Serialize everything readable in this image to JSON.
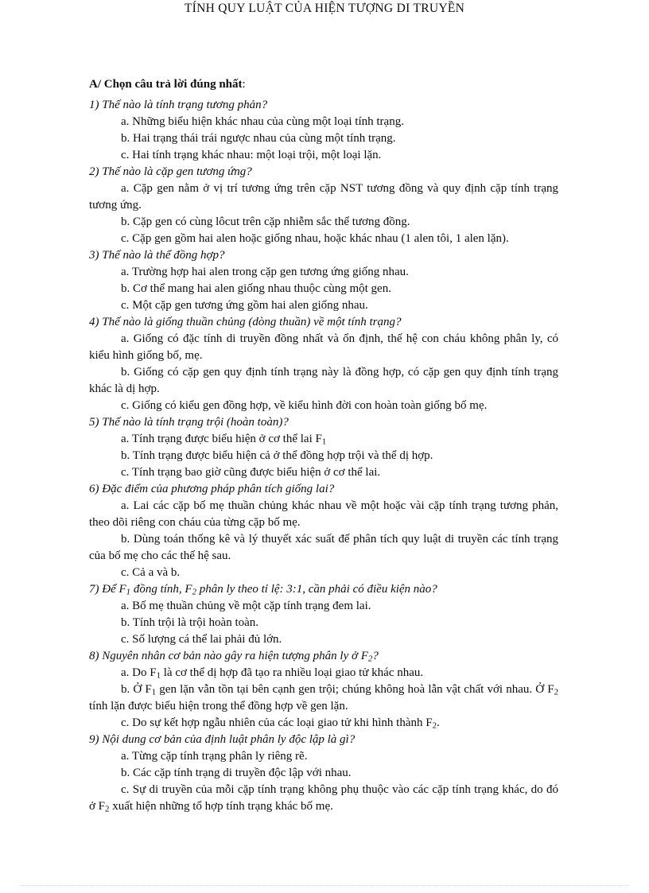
{
  "document": {
    "title": "TÍNH QUY LUẬT CỦA HIỆN TƯỢNG DI TRUYỀN",
    "section_label": "A/ Chọn câu trả lời đúng nhất",
    "section_label_tail": ":"
  },
  "questions": [
    {
      "number": "1)",
      "prompt": "1) Thế nào là tính trạng tương phản?",
      "options": [
        "a.  Những biểu hiện khác nhau của cùng một loại tính trạng.",
        "b.  Hai trạng thái trái ngược nhau của cùng một tính trạng.",
        "c.  Hai tính trạng khác nhau: một loại trội, một loại lặn."
      ]
    },
    {
      "number": "2)",
      "prompt": "2) Thế nào là cặp gen tương ứng?",
      "options": [
        "a.  Cặp gen nằm ở vị trí tương ứng trên cặp NST tương đồng và quy định cặp tính trạng tương ứng.",
        "b.  Cặp gen có cùng lôcut trên cặp nhiễm sắc thể tương đồng.",
        "c.  Cặp gen gồm hai alen hoặc giống nhau, hoặc khác nhau (1 alen tôi, 1 alen lặn)."
      ]
    },
    {
      "number": "3)",
      "prompt": "3) Thế nào là thể đồng hợp?",
      "options": [
        "a.  Trường hợp hai alen trong cặp gen tương ứng giống nhau.",
        "b.  Cơ thể mang hai alen giống nhau thuộc cùng một gen.",
        "c.  Một cặp gen tương ứng gồm hai alen giống nhau."
      ]
    },
    {
      "number": "4)",
      "prompt": "4) Thế nào là giống thuần chủng (dòng thuần) về một tính trạng?",
      "options": [
        "a.  Giống có đặc tính di truyền đồng nhất và ổn định, thế hệ con cháu không phân ly, có kiểu hình giống bố, mẹ.",
        "b.  Giống có cặp gen quy định tính trạng này là đồng hợp, có cặp gen quy định tính trạng khác là dị hợp.",
        "c.  Giống có kiểu gen đồng hợp, về kiểu hình đời con hoàn toàn giống bố mẹ."
      ]
    },
    {
      "number": "5)",
      "prompt": "5) Thế nào là tính trạng trội (hoàn toàn)?",
      "options": [
        "a.  Tính trạng được biểu hiện ở cơ thể lai F<sub>1</sub>",
        "b.  Tính trạng được biểu hiện cả ở thể đồng hợp trội và thể dị hợp.",
        "c.  Tính trạng bao giờ cũng được biểu hiện ở cơ thể lai."
      ]
    },
    {
      "number": "6)",
      "prompt": "6) Đặc điểm của phương pháp phân tích giống lai?",
      "options": [
        "a.  Lai các cặp bố mẹ thuần chủng khác nhau về một hoặc vài cặp tính trạng tương phản, theo dõi riêng con cháu của từng cặp bố mẹ.",
        "b.  Dùng toán thống kê và lý thuyết xác suất để phân tích quy luật di truyền các tính trạng của bố mẹ cho các thế hệ sau.",
        "c.  Cả a và b."
      ]
    },
    {
      "number": "7)",
      "prompt": "7) Để F<sub>1</sub> đồng tính, F<sub>2</sub> phân ly theo tỉ lệ: 3:1, cần phải có điều kiện nào?",
      "options": [
        "a.  Bố mẹ thuần chủng về một cặp tính trạng đem lai.",
        "b.  Tính trội là trội hoàn toàn.",
        "c.  Số lượng cá thể lai phải đủ lớn."
      ]
    },
    {
      "number": "8)",
      "prompt": "8) Nguyên nhân cơ bản nào gây ra hiện tượng phân ly ở F<sub>2</sub>?",
      "options": [
        "a.  Do F<sub>1</sub> là cơ thể dị hợp đã tạo ra nhiều loại giao tử khác nhau.",
        "b.  Ở F<sub>1</sub> gen lặn vẫn tồn tại bên cạnh gen trội; chúng không hoà lẫn vật chất với nhau. Ở F<sub>2</sub> tính lặn được biểu hiện trong thể đồng hợp về gen lặn.",
        "c.  Do sự kết hợp ngẫu nhiên của các loại giao tử khi hình thành F<sub>2</sub>."
      ]
    },
    {
      "number": "9)",
      "prompt": "9) Nội dung cơ bản của định luật phân ly độc lập là gì?",
      "options": [
        "a.  Từng cặp tính trạng phân ly riêng rẽ.",
        "b.  Các cặp tính trạng di truyền độc lập với nhau.",
        "c.  Sự di truyền của mỗi cặp tính trạng không phụ thuộc vào các cặp tính trạng khác, do đó ở F<sub>2</sub> xuất hiện những tổ hợp tính trạng khác bố mẹ."
      ]
    }
  ],
  "decoration": {
    "footer_rule_color": "#f8c8d8"
  }
}
